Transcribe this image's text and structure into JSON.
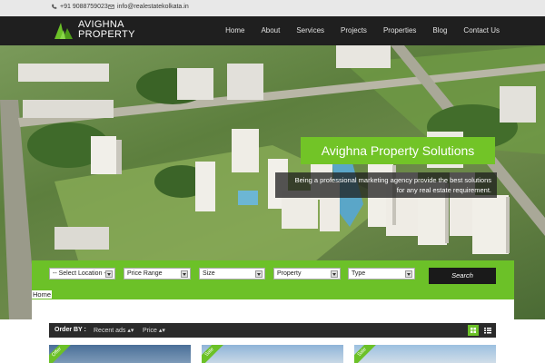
{
  "topbar": {
    "phone": "+91 9088759023",
    "email": "info@realestatekolkata.in"
  },
  "brand": {
    "line1": "AVIGHNA",
    "line2": "PROPERTY",
    "accent": "#6cc128"
  },
  "nav": {
    "items": [
      "Home",
      "About",
      "Services",
      "Projects",
      "Properties",
      "Blog",
      "Contact Us"
    ]
  },
  "hero": {
    "title": "Avighna Property Solutions",
    "subtitle_line1": "Being a professional marketing agency provide the best solutions",
    "subtitle_line2": "for any real estate requirement."
  },
  "search": {
    "location": "-- Select Location --",
    "price_range": "Price Range",
    "size": "Size",
    "property": "Property",
    "type": "Type",
    "button": "Search"
  },
  "breadcrumb": "Home",
  "order": {
    "label": "Order BY :",
    "recent": "Recent ads",
    "price": "Price"
  },
  "cards": {
    "c1_ribbon": "Offer",
    "c2_ribbon": "Sale",
    "c3_ribbon": "Sale"
  }
}
